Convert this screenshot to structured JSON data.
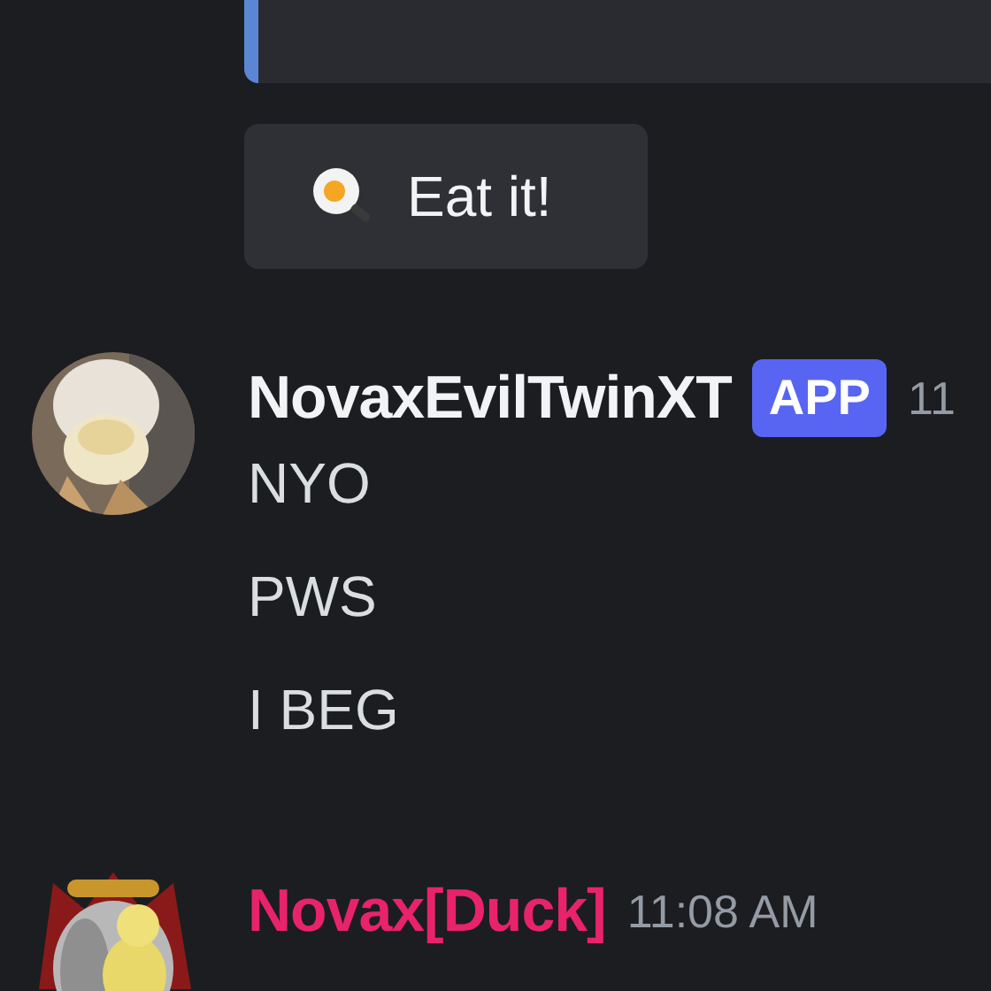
{
  "embed": {
    "kind": "card"
  },
  "action_button": {
    "label": "Eat it!"
  },
  "messages": [
    {
      "author": "NovaxEvilTwinXT",
      "color": "#f2f3f5",
      "badge": "APP",
      "timestamp": "11",
      "lines": [
        "NYO",
        "PWS",
        "I BEG"
      ]
    },
    {
      "author": "Novax[Duck]",
      "color": "#e8236b",
      "timestamp": "11:08 AM"
    }
  ]
}
